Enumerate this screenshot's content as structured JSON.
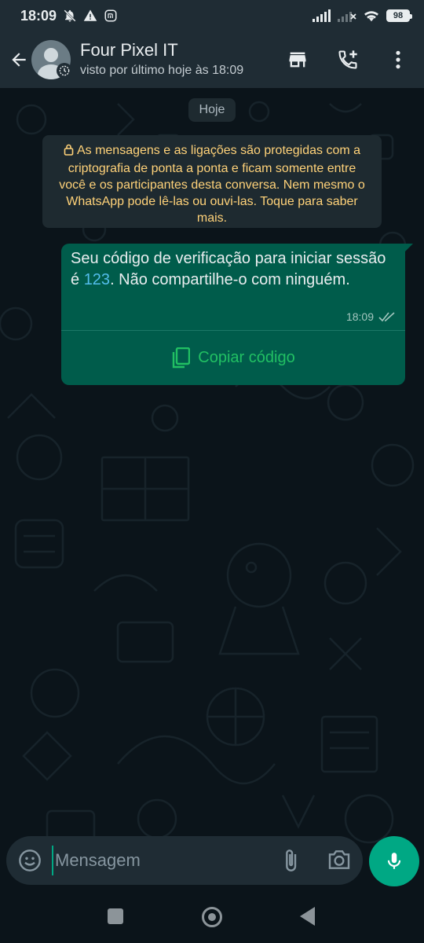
{
  "status_bar": {
    "time": "18:09",
    "battery": "98"
  },
  "header": {
    "contact_name": "Four Pixel IT",
    "contact_status": "visto por último hoje às 18:09"
  },
  "chat": {
    "date_label": "Hoje",
    "encryption_notice": "As mensagens e as ligações são protegidas com a criptografia de ponta a ponta e ficam somente entre você e os participantes desta conversa. Nem mesmo o WhatsApp pode lê-las ou ouvi-las. Toque para saber mais.",
    "message": {
      "text_before": "Seu código de verificação para iniciar sessão é ",
      "code": "123",
      "text_after": ". Não compartilhe-o com ninguém.",
      "time": "18:09",
      "copy_button_label": "Copiar código"
    }
  },
  "composer": {
    "placeholder": "Mensagem"
  },
  "colors": {
    "header_bg": "#1f2c34",
    "chat_bg": "#0b141a",
    "outgoing_bubble": "#005c4b",
    "notice_text": "#ffd279",
    "accent_green": "#00a884",
    "copy_green": "#21c063",
    "code_link": "#53bdeb"
  },
  "icons": {
    "status_bar": [
      "notifications-off-icon",
      "warning-icon",
      "mi-icon",
      "signal-icon",
      "signal-off-icon",
      "wifi-icon",
      "battery-icon"
    ],
    "header": [
      "back-arrow-icon",
      "store-icon",
      "add-call-icon",
      "more-vert-icon"
    ],
    "composer": [
      "emoji-icon",
      "attach-icon",
      "camera-icon",
      "mic-icon"
    ]
  }
}
